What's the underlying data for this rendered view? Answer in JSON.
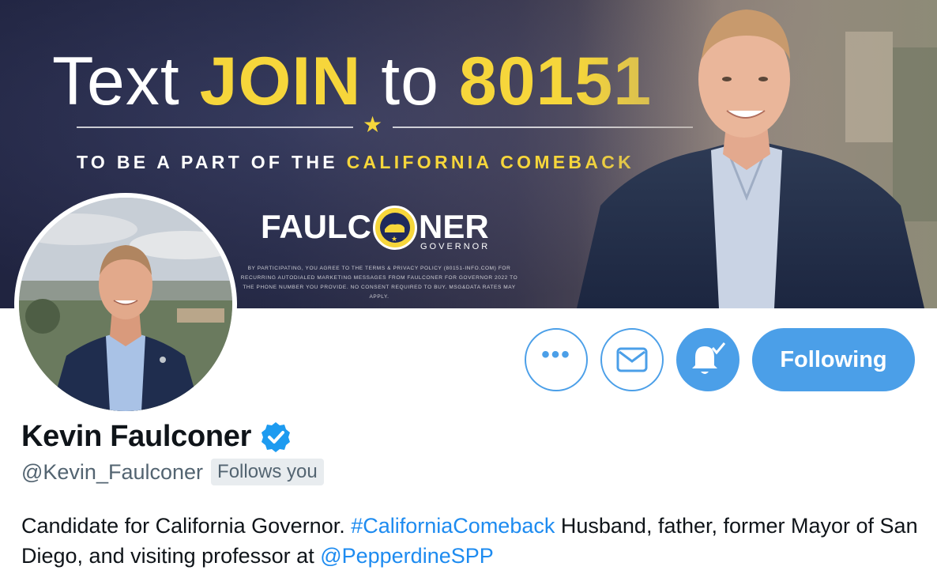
{
  "banner": {
    "headline_prefix": "Text ",
    "headline_keyword": "JOIN",
    "headline_mid": " to ",
    "headline_number": "80151",
    "tagline_white": "TO BE A PART OF THE ",
    "tagline_yellow": "CALIFORNIA COMEBACK",
    "logo_left": "FAULC",
    "logo_right": "NER",
    "logo_sub": "GOVERNOR",
    "disclaimer": "BY PARTICIPATING, YOU AGREE TO THE TERMS & PRIVACY POLICY (80151-INFO.COM) FOR RECURRING AUTODIALED MARKETING MESSAGES FROM FAULCONER FOR GOVERNOR 2022 TO THE PHONE NUMBER YOU PROVIDE. NO CONSENT REQUIRED TO BUY. MSG&DATA RATES MAY APPLY."
  },
  "actions": {
    "more_label": "•••",
    "following_label": "Following"
  },
  "profile": {
    "display_name": "Kevin Faulconer",
    "handle": "@Kevin_Faulconer",
    "follows_you": "Follows you",
    "bio_part1": "Candidate for California Governor. ",
    "bio_hashtag": "#CaliforniaComeback",
    "bio_part2": " Husband, father, former Mayor of San Diego, and visiting professor at ",
    "bio_mention": "@PepperdineSPP"
  },
  "colors": {
    "accent": "#4b9fe8",
    "link": "#1d8bf0",
    "banner_yellow": "#f6d63b",
    "text_secondary": "#536471"
  }
}
